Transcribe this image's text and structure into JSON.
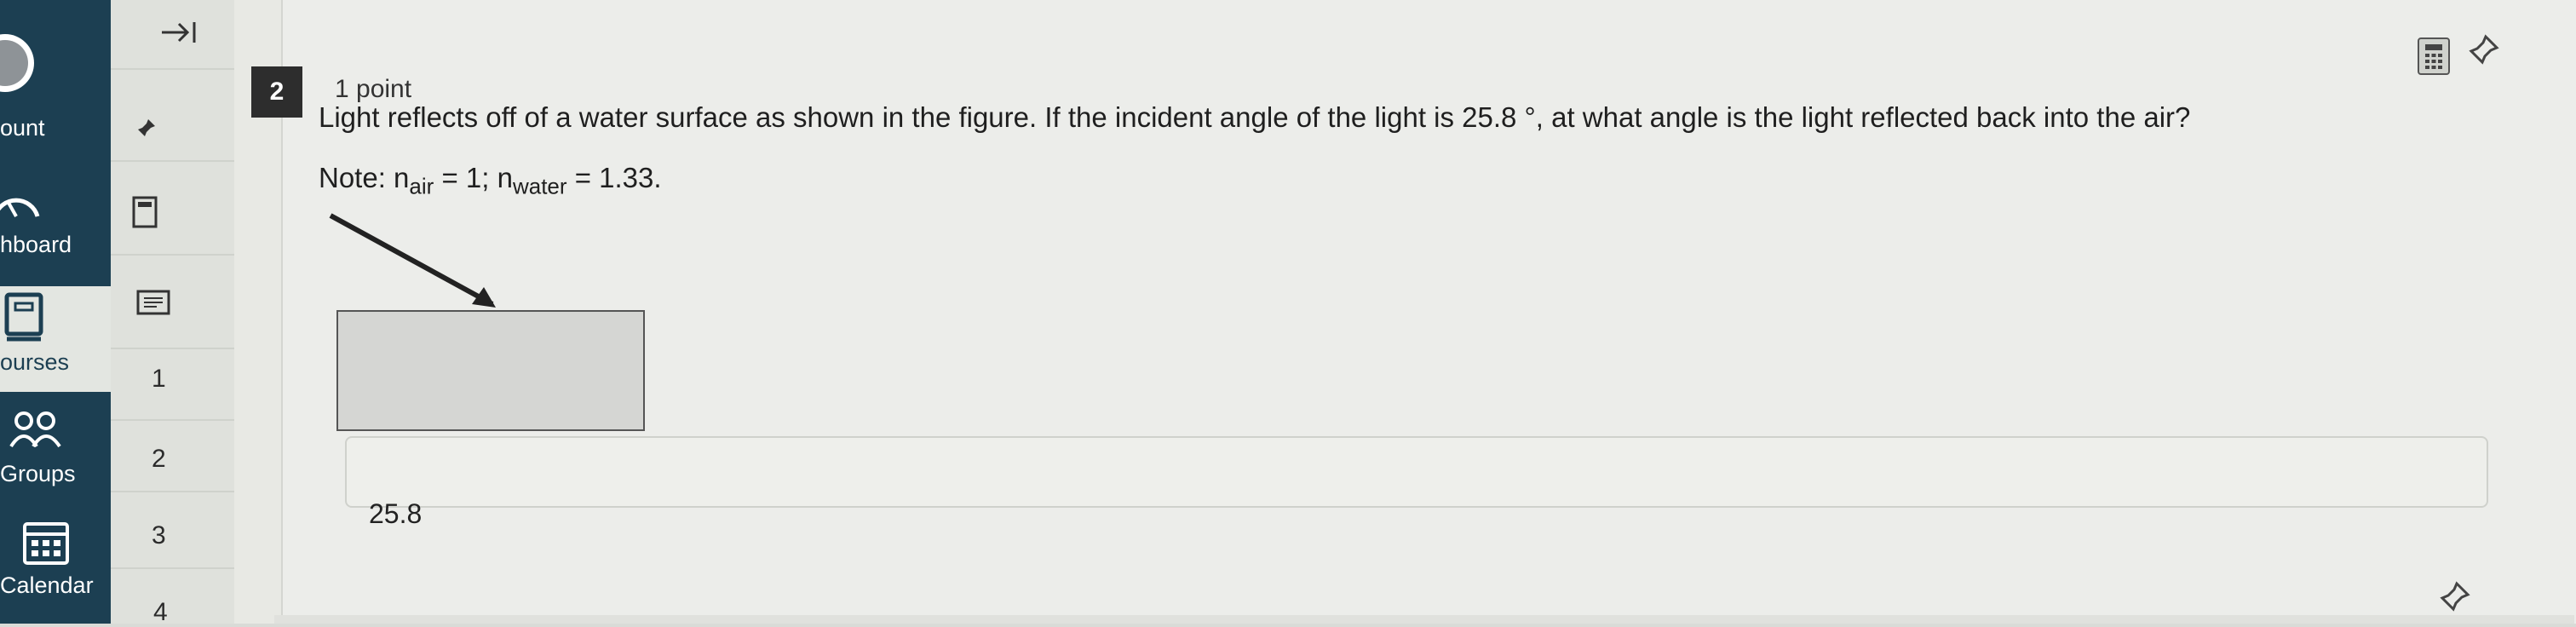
{
  "global_nav": {
    "items": [
      {
        "label": "ount",
        "icon": "account-avatar-icon"
      },
      {
        "label": "hboard",
        "icon": "dashboard-gauge-icon"
      },
      {
        "label": "ourses",
        "icon": "courses-book-icon"
      },
      {
        "label": "Groups",
        "icon": "groups-people-icon"
      },
      {
        "label": "Calendar",
        "icon": "calendar-icon"
      }
    ]
  },
  "quiz_nav": {
    "expand_icon": "expand-arrow-icon",
    "pin_icon": "pin-icon",
    "tools": [
      "calculator-icon",
      "notes-icon"
    ],
    "numbers": [
      "1",
      "2",
      "3",
      "4"
    ]
  },
  "question": {
    "number": "2",
    "points": "1 point",
    "text": "Light reflects off of a water surface as shown in the figure. If the incident angle of the light is 25.8 °, at what angle is the light reflected back into the air?",
    "note_prefix": "Note: n",
    "note_air_sub": "air",
    "note_mid": " = 1; n",
    "note_water_sub": "water",
    "note_suffix": " = 1.33."
  },
  "answer": {
    "value": "25.8"
  },
  "toolbar": {
    "calculator_icon": "calculator-icon",
    "pin_icon": "pin-icon"
  },
  "colors": {
    "nav_bg": "#1c3f52",
    "content_bg": "#ecedea",
    "badge_bg": "#2d2d2d"
  }
}
